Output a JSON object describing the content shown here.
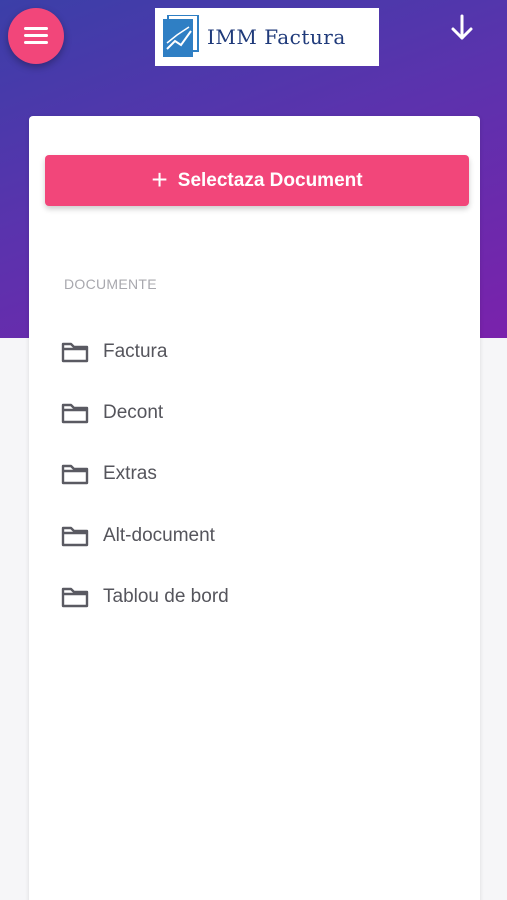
{
  "header": {
    "logo_text": "IMM Factura",
    "menu_icon": "hamburger-icon",
    "download_icon": "arrow-down-icon"
  },
  "card": {
    "select_button_label": "Selectaza Document",
    "select_button_icon": "plus-icon",
    "section_label": "DOCUMENTE",
    "folders": [
      {
        "label": "Factura",
        "icon": "folder-icon"
      },
      {
        "label": "Decont",
        "icon": "folder-icon"
      },
      {
        "label": "Extras",
        "icon": "folder-icon"
      },
      {
        "label": "Alt-document",
        "icon": "folder-icon"
      },
      {
        "label": "Tablou de bord",
        "icon": "folder-icon"
      }
    ]
  },
  "colors": {
    "accent": "#f2467a",
    "header_gradient_start": "#3b3fa8",
    "header_gradient_end": "#7a22ac",
    "logo_text": "#1f3a7a"
  }
}
